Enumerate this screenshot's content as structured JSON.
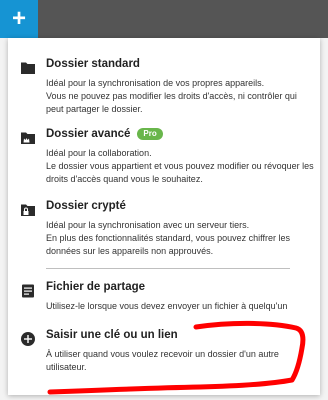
{
  "toolbar": {
    "add_icon": "plus-icon",
    "add_glyph": "+",
    "accent_color": "#1694d3",
    "bar_color": "#555555"
  },
  "menu": {
    "items": [
      {
        "icon": "folder-icon",
        "title": "Dossier standard",
        "lines": [
          "Idéal pour la synchronisation de vos propres appareils.",
          "Vous ne pouvez pas modifier les droits d'accès, ni contrôler qui peut partager le dossier."
        ]
      },
      {
        "icon": "crown-folder-icon",
        "title": "Dossier avancé",
        "badge": "Pro",
        "badge_color": "#69b64b",
        "lines": [
          "Idéal pour la collaboration.",
          "Le dossier vous appartient et vous pouvez modifier ou révoquer les droits d'accès quand vous le souhaitez."
        ]
      },
      {
        "icon": "lock-folder-icon",
        "title": "Dossier crypté",
        "lines": [
          "Idéal pour la synchronisation avec un serveur tiers.",
          "En plus des fonctionnalités standard, vous pouvez chiffrer les données sur les appareils non approuvés."
        ]
      },
      {
        "icon": "document-icon",
        "title": "Fichier de partage",
        "lines": [
          "Utilisez-le lorsque vous devez envoyer un fichier à quelqu'un"
        ]
      },
      {
        "icon": "add-circle-icon",
        "title": "Saisir une clé ou un lien",
        "lines": [
          "À utiliser quand vous voulez recevoir un dossier d'un autre utilisateur."
        ]
      }
    ]
  },
  "annotation": {
    "icon": "red-marker-underline",
    "color": "#ff0000"
  }
}
